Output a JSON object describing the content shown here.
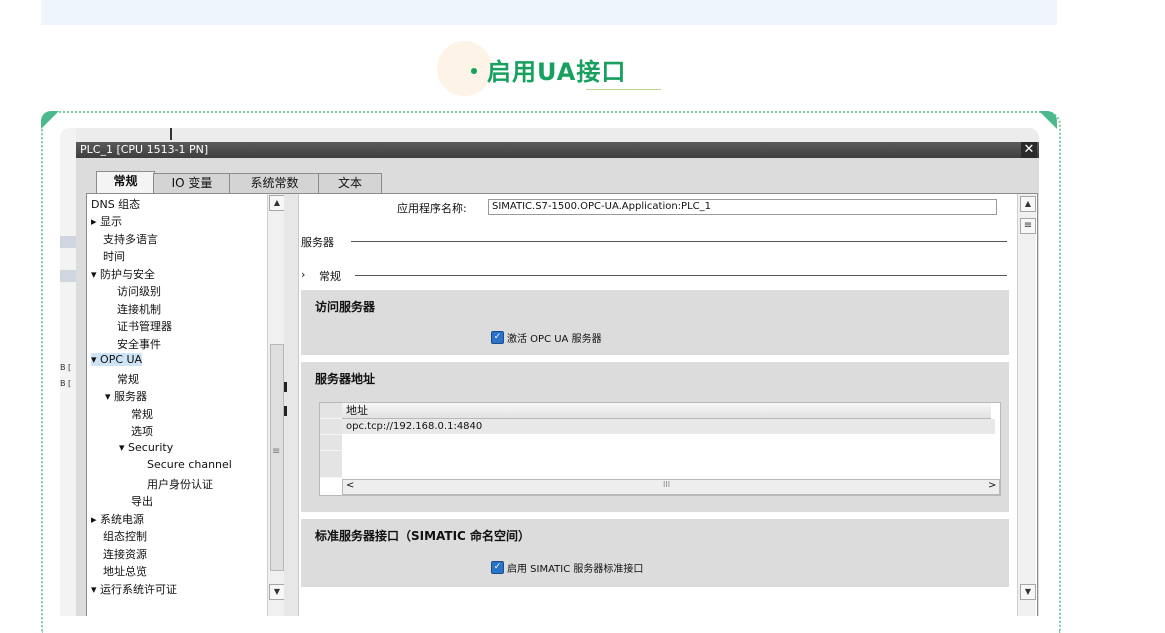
{
  "heading": {
    "text": "・启用UA接口"
  },
  "dialog": {
    "title": "PLC_1 [CPU 1513-1 PN]",
    "close_glyph": "✕",
    "tabs": [
      {
        "label": "常规",
        "active": true
      },
      {
        "label": "IO 变量",
        "active": false
      },
      {
        "label": "系统常数",
        "active": false
      },
      {
        "label": "文本",
        "active": false
      }
    ]
  },
  "background_window": {
    "row_labels": [
      "B [",
      "B ["
    ]
  },
  "nav": {
    "items": [
      {
        "label": "DNS 组态",
        "prefix": ""
      },
      {
        "label": "显示",
        "prefix": "▸ "
      },
      {
        "label": "支持多语言",
        "prefix": ""
      },
      {
        "label": "时间",
        "prefix": ""
      },
      {
        "label": "防护与安全",
        "prefix": "▾ "
      },
      {
        "label": "访问级别",
        "prefix": ""
      },
      {
        "label": "连接机制",
        "prefix": ""
      },
      {
        "label": "证书管理器",
        "prefix": ""
      },
      {
        "label": "安全事件",
        "prefix": ""
      },
      {
        "label": "OPC UA",
        "prefix": "▾ "
      },
      {
        "label": "常规",
        "prefix": ""
      },
      {
        "label": "服务器",
        "prefix": "▾ "
      },
      {
        "label": "常规",
        "prefix": ""
      },
      {
        "label": "选项",
        "prefix": ""
      },
      {
        "label": "Security",
        "prefix": "▾ "
      },
      {
        "label": "Secure channel",
        "prefix": ""
      },
      {
        "label": "用户身份认证",
        "prefix": ""
      },
      {
        "label": "导出",
        "prefix": ""
      },
      {
        "label": "系统电源",
        "prefix": "▸ "
      },
      {
        "label": "组态控制",
        "prefix": ""
      },
      {
        "label": "连接资源",
        "prefix": ""
      },
      {
        "label": "地址总览",
        "prefix": ""
      },
      {
        "label": "运行系统许可证",
        "prefix": "▾ "
      }
    ],
    "selected_index": 9
  },
  "main": {
    "app_name_label": "应用程序名称:",
    "app_name_value": "SIMATIC.S7-1500.OPC-UA.Application:PLC_1",
    "server_header": "服务器",
    "general_header": "常规",
    "general_arrow": "›",
    "access_section": {
      "title": "访问服务器",
      "checkbox_label": "激活 OPC UA 服务器",
      "checked": true
    },
    "address_section": {
      "title": "服务器地址",
      "column_header": "地址",
      "rows": [
        "opc.tcp://192.168.0.1:4840"
      ],
      "scroll_left": "<",
      "scroll_right": ">",
      "scroll_mid": "III"
    },
    "standard_section": {
      "title": "标准服务器接口（SIMATIC 命名空间）",
      "checkbox_label": "启用 SIMATIC 服务器标准接口",
      "checked": true
    }
  },
  "scroll": {
    "up": "▲",
    "down": "▼",
    "grip": "≡"
  },
  "checkmark": "✓"
}
